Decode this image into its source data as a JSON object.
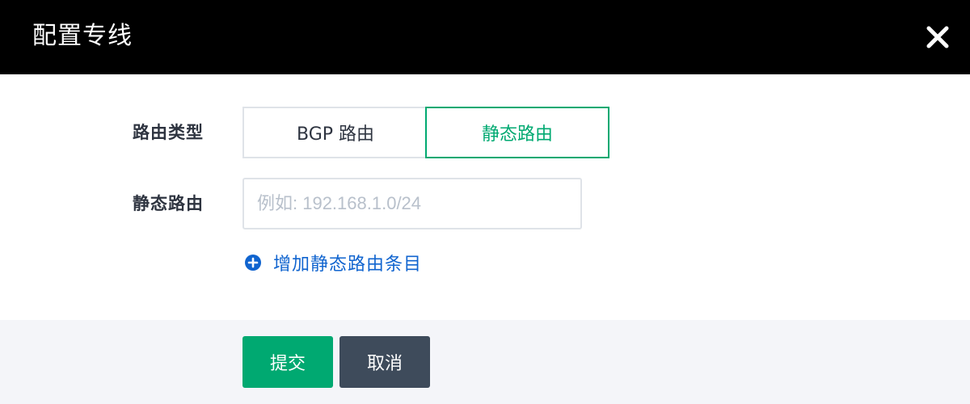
{
  "dialog": {
    "title": "配置专线",
    "close_icon": "close-icon"
  },
  "form": {
    "route_type": {
      "label": "路由类型",
      "options": [
        "BGP 路由",
        "静态路由"
      ],
      "selected": "静态路由"
    },
    "static_route": {
      "label": "静态路由",
      "value": "",
      "placeholder": "例如: 192.168.1.0/24"
    },
    "add_entry": {
      "icon": "plus-circle-icon",
      "label": "增加静态路由条目"
    }
  },
  "footer": {
    "submit_label": "提交",
    "cancel_label": "取消"
  },
  "colors": {
    "header_bg": "#000000",
    "accent_green": "#00a971",
    "link_blue": "#1064cf",
    "cancel_bg": "#3e4b5b",
    "footer_bg": "#f4f5f9"
  }
}
